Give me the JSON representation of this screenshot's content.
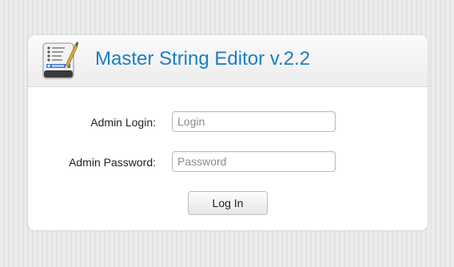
{
  "app": {
    "title": "Master String Editor v.2.2",
    "icon": "notepad-pencil-icon",
    "accent_color": "#1b7fc1"
  },
  "form": {
    "login_label": "Admin Login:",
    "login_placeholder": "Login",
    "login_value": "",
    "password_label": "Admin Password:",
    "password_placeholder": "Password",
    "password_value": "",
    "submit_label": "Log In"
  }
}
